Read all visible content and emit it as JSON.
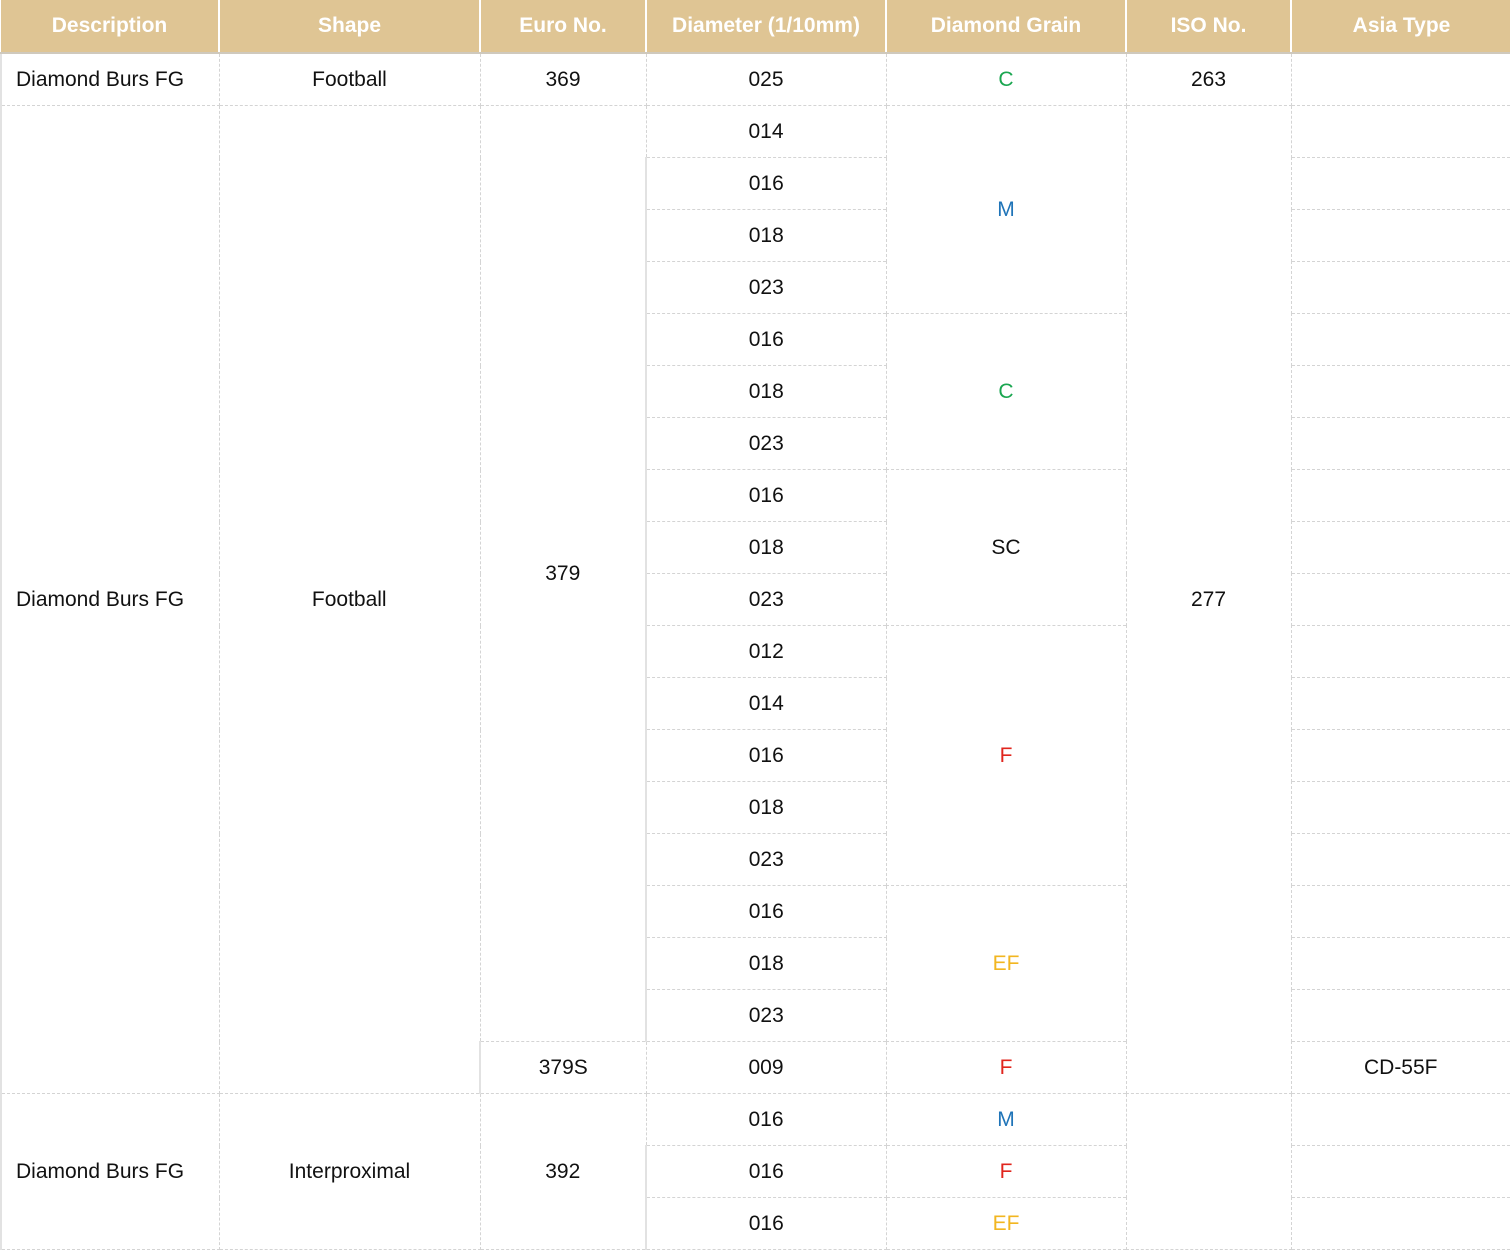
{
  "headers": [
    "Description",
    "Shape",
    "Euro No.",
    "Diameter (1/10mm)",
    "Diamond Grain",
    "ISO No.",
    "Asia Type"
  ],
  "grain_colors": {
    "C": "#1aa650",
    "M": "#1f74b8",
    "SC": "#111111",
    "F": "#e0261e",
    "EF": "#f2b620"
  },
  "groups": [
    {
      "description": "Diamond Burs FG",
      "shape": "Football",
      "variants": [
        {
          "euro": "369",
          "iso": "263",
          "grains": [
            {
              "grain": "C",
              "rows": [
                {
                  "diameter": "025",
                  "asia": ""
                }
              ]
            }
          ]
        }
      ]
    },
    {
      "description": "Diamond Burs FG",
      "shape": "Football",
      "variants": [
        {
          "euro": "379",
          "iso": "277",
          "grains": [
            {
              "grain": "M",
              "rows": [
                {
                  "diameter": "014",
                  "asia": ""
                },
                {
                  "diameter": "016",
                  "asia": ""
                },
                {
                  "diameter": "018",
                  "asia": ""
                },
                {
                  "diameter": "023",
                  "asia": ""
                }
              ]
            },
            {
              "grain": "C",
              "rows": [
                {
                  "diameter": "016",
                  "asia": ""
                },
                {
                  "diameter": "018",
                  "asia": ""
                },
                {
                  "diameter": "023",
                  "asia": ""
                }
              ]
            },
            {
              "grain": "SC",
              "rows": [
                {
                  "diameter": "016",
                  "asia": ""
                },
                {
                  "diameter": "018",
                  "asia": ""
                },
                {
                  "diameter": "023",
                  "asia": ""
                }
              ]
            },
            {
              "grain": "F",
              "rows": [
                {
                  "diameter": "012",
                  "asia": ""
                },
                {
                  "diameter": "014",
                  "asia": ""
                },
                {
                  "diameter": "016",
                  "asia": ""
                },
                {
                  "diameter": "018",
                  "asia": ""
                },
                {
                  "diameter": "023",
                  "asia": ""
                }
              ]
            },
            {
              "grain": "EF",
              "rows": [
                {
                  "diameter": "016",
                  "asia": ""
                },
                {
                  "diameter": "018",
                  "asia": ""
                },
                {
                  "diameter": "023",
                  "asia": ""
                }
              ]
            }
          ]
        },
        {
          "euro": "379S",
          "iso": "277",
          "grains": [
            {
              "grain": "F",
              "rows": [
                {
                  "diameter": "009",
                  "asia": "CD-55F"
                }
              ]
            }
          ]
        }
      ]
    },
    {
      "description": "Diamond Burs FG",
      "shape": "Interproximal",
      "variants": [
        {
          "euro": "392",
          "iso": "",
          "grains": [
            {
              "grain": "M",
              "rows": [
                {
                  "diameter": "016",
                  "asia": ""
                }
              ]
            },
            {
              "grain": "F",
              "rows": [
                {
                  "diameter": "016",
                  "asia": ""
                }
              ]
            },
            {
              "grain": "EF",
              "rows": [
                {
                  "diameter": "016",
                  "asia": ""
                }
              ]
            }
          ]
        }
      ]
    }
  ]
}
